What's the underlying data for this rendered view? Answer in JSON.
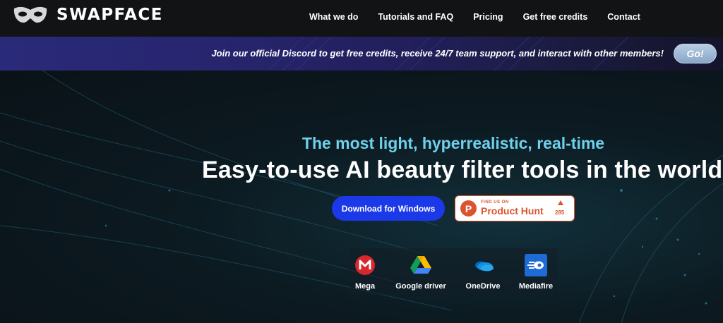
{
  "brand": {
    "name": "SWAPFACE",
    "logo_icon": "mask-icon"
  },
  "nav": {
    "items": [
      {
        "label": "What we do"
      },
      {
        "label": "Tutorials and FAQ"
      },
      {
        "label": "Pricing"
      },
      {
        "label": "Get free credits"
      },
      {
        "label": "Contact"
      }
    ]
  },
  "banner": {
    "text": "Join our official Discord to get free credits, receive 24/7 team support, and interact with other members!",
    "go_label": "Go!"
  },
  "hero": {
    "subtitle": "The most light, hyperrealistic, real-time",
    "title": "Easy-to-use AI beauty filter tools in the world!",
    "download_label": "Download for Windows",
    "producthunt": {
      "small": "FIND US ON",
      "name": "Product Hunt",
      "count": "285",
      "logo_letter": "P"
    }
  },
  "mirrors": [
    {
      "label": "Mega",
      "icon": "mega-icon"
    },
    {
      "label": "Google driver",
      "icon": "google-drive-icon"
    },
    {
      "label": "OneDrive",
      "icon": "onedrive-icon"
    },
    {
      "label": "Mediafire",
      "icon": "mediafire-icon"
    }
  ],
  "colors": {
    "accent_blue": "#1b39e8",
    "subtitle_cyan": "#6fd0ec",
    "producthunt": "#da552f"
  }
}
